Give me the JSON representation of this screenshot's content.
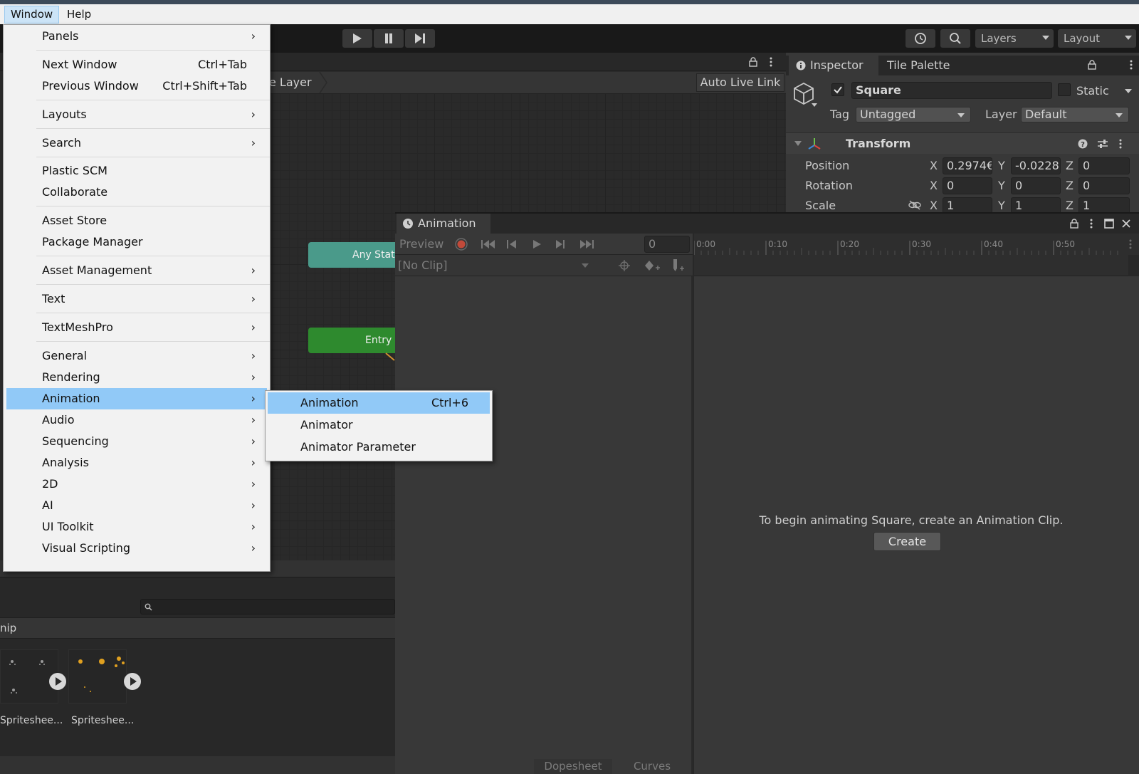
{
  "menubar": {
    "items": [
      "Window",
      "Help"
    ]
  },
  "toolbar": {
    "layers_label": "Layers",
    "layout_label": "Layout"
  },
  "window_menu": {
    "items": [
      {
        "label": "Panels",
        "shortcut": "",
        "submenu": true
      },
      {
        "label": "Next Window",
        "shortcut": "Ctrl+Tab",
        "submenu": false
      },
      {
        "label": "Previous Window",
        "shortcut": "Ctrl+Shift+Tab",
        "submenu": false
      },
      {
        "label": "Layouts",
        "shortcut": "",
        "submenu": true
      },
      {
        "label": "Search",
        "shortcut": "",
        "submenu": true
      },
      {
        "label": "Plastic SCM",
        "shortcut": "",
        "submenu": false
      },
      {
        "label": "Collaborate",
        "shortcut": "",
        "submenu": false
      },
      {
        "label": "Asset Store",
        "shortcut": "",
        "submenu": false
      },
      {
        "label": "Package Manager",
        "shortcut": "",
        "submenu": false
      },
      {
        "label": "Asset Management",
        "shortcut": "",
        "submenu": true
      },
      {
        "label": "Text",
        "shortcut": "",
        "submenu": true
      },
      {
        "label": "TextMeshPro",
        "shortcut": "",
        "submenu": true
      },
      {
        "label": "General",
        "shortcut": "",
        "submenu": true
      },
      {
        "label": "Rendering",
        "shortcut": "",
        "submenu": true
      },
      {
        "label": "Animation",
        "shortcut": "",
        "submenu": true,
        "highlighted": true
      },
      {
        "label": "Audio",
        "shortcut": "",
        "submenu": true
      },
      {
        "label": "Sequencing",
        "shortcut": "",
        "submenu": true
      },
      {
        "label": "Analysis",
        "shortcut": "",
        "submenu": true
      },
      {
        "label": "2D",
        "shortcut": "",
        "submenu": true
      },
      {
        "label": "AI",
        "shortcut": "",
        "submenu": true
      },
      {
        "label": "UI Toolkit",
        "shortcut": "",
        "submenu": true
      },
      {
        "label": "Visual Scripting",
        "shortcut": "",
        "submenu": true
      }
    ]
  },
  "animation_submenu": {
    "items": [
      {
        "label": "Animation",
        "shortcut": "Ctrl+6",
        "highlighted": true
      },
      {
        "label": "Animator",
        "shortcut": ""
      },
      {
        "label": "Animator Parameter",
        "shortcut": ""
      }
    ]
  },
  "animator": {
    "breadcrumb": "e Layer",
    "auto_live_link": "Auto Live Link",
    "node_any_state": "Any Stat",
    "node_entry": "Entry"
  },
  "project": {
    "crumb": "nip",
    "assets": [
      {
        "label": "Spriteshee..."
      },
      {
        "label": "Spriteshee..."
      }
    ]
  },
  "inspector": {
    "tabs": [
      "Inspector",
      "Tile Palette"
    ],
    "object_name": "Square",
    "static_label": "Static",
    "tag_label": "Tag",
    "tag_value": "Untagged",
    "layer_label": "Layer",
    "layer_value": "Default",
    "transform_title": "Transform",
    "position_label": "Position",
    "rotation_label": "Rotation",
    "scale_label": "Scale",
    "axis_x": "X",
    "axis_y": "Y",
    "axis_z": "Z",
    "position": {
      "x": "0.2974€",
      "y": "-0.0228",
      "z": "0"
    },
    "rotation": {
      "x": "0",
      "y": "0",
      "z": "0"
    },
    "scale": {
      "x": "1",
      "y": "1",
      "z": "1"
    }
  },
  "animation_window": {
    "tab_title": "Animation",
    "preview_label": "Preview",
    "frame_value": "0",
    "clip_value": "[No Clip]",
    "ruler_labels": [
      "0:00",
      "0:10",
      "0:20",
      "0:30",
      "0:40",
      "0:50"
    ],
    "empty_message": "To begin animating Square, create an Animation Clip.",
    "create_button": "Create",
    "bottom_tabs": [
      "Dopesheet",
      "Curves"
    ]
  },
  "colors": {
    "menu_highlight": "#91c9f7",
    "record_red": "#c24a3a",
    "editor_bg": "#383838"
  }
}
